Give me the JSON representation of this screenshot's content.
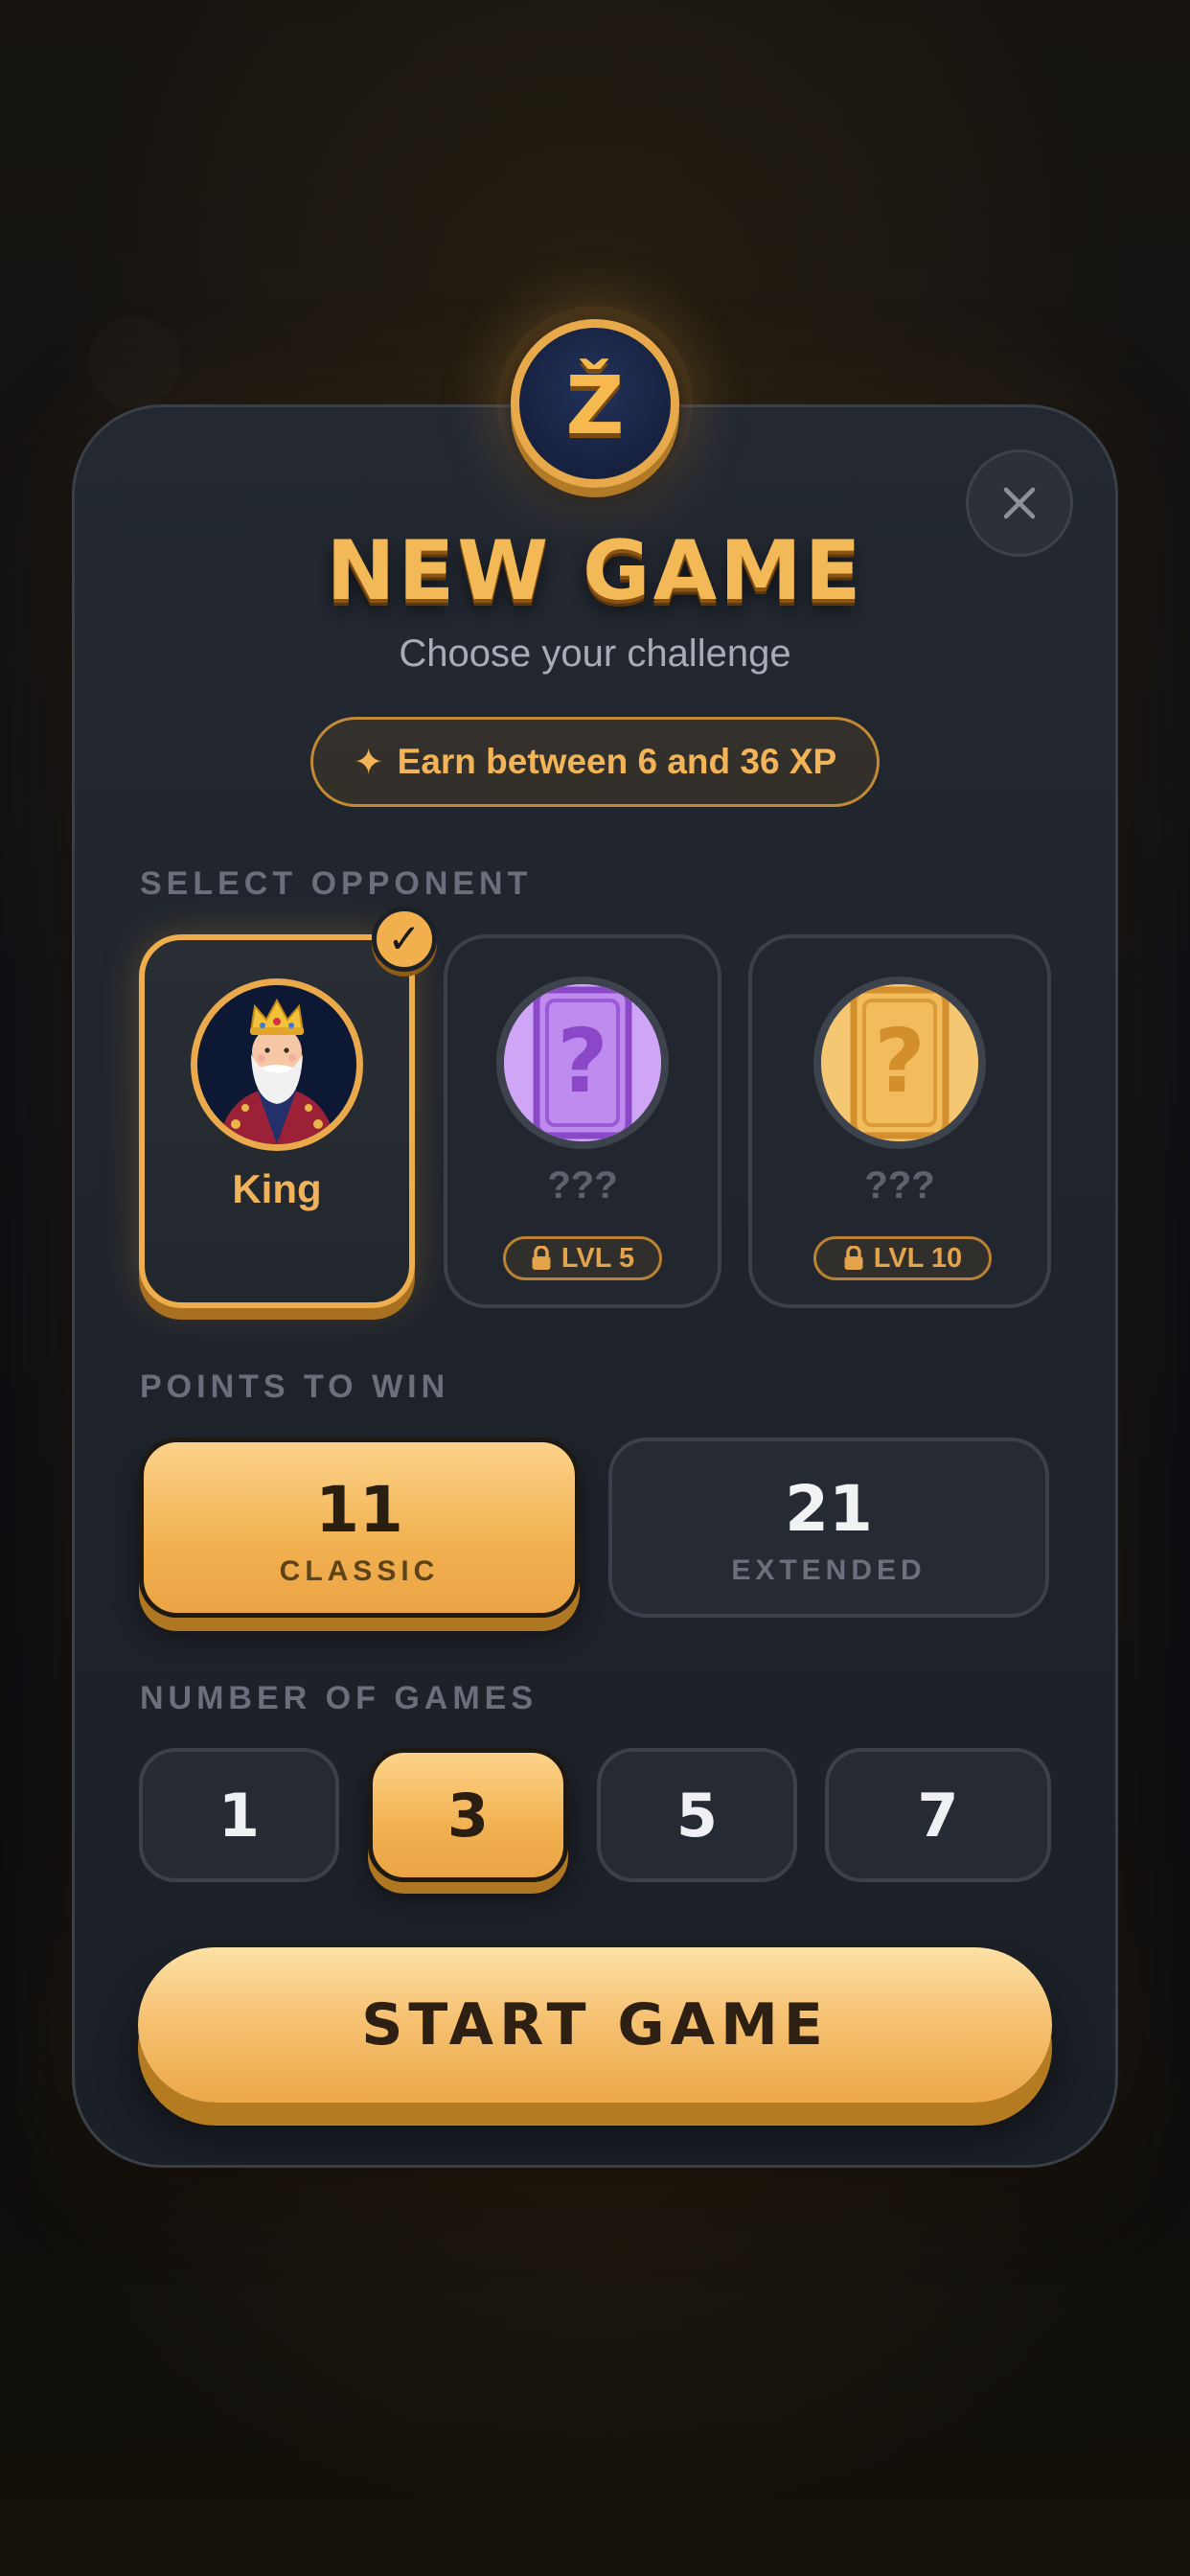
{
  "badge": {
    "letter": "Ž",
    "icon": "coin-badge-icon"
  },
  "header": {
    "title": "NEW GAME",
    "subtitle": "Choose your challenge",
    "xp_text": "Earn between 6 and 36 XP",
    "xp_icon": "sparkle-icon"
  },
  "close": {
    "icon": "close-icon"
  },
  "opponents": {
    "label": "SELECT OPPONENT",
    "items": [
      {
        "name": "King",
        "selected": true,
        "locked": false,
        "avatar": "king-avatar"
      },
      {
        "name": "???",
        "selected": false,
        "locked": true,
        "lock_label": "LVL 5",
        "avatar": "mystery-card-purple"
      },
      {
        "name": "???",
        "selected": false,
        "locked": true,
        "lock_label": "LVL 10",
        "avatar": "mystery-card-gold"
      }
    ]
  },
  "points": {
    "label": "POINTS TO WIN",
    "options": [
      {
        "value": "11",
        "caption": "CLASSIC",
        "selected": true
      },
      {
        "value": "21",
        "caption": "EXTENDED",
        "selected": false
      }
    ]
  },
  "games": {
    "label": "NUMBER OF GAMES",
    "options": [
      "1",
      "3",
      "5",
      "7"
    ],
    "selected": "3"
  },
  "start": {
    "label": "START GAME"
  },
  "colors": {
    "accent": "#f2b150",
    "card_bg": "#1f232b",
    "text_muted": "#6a707b"
  }
}
